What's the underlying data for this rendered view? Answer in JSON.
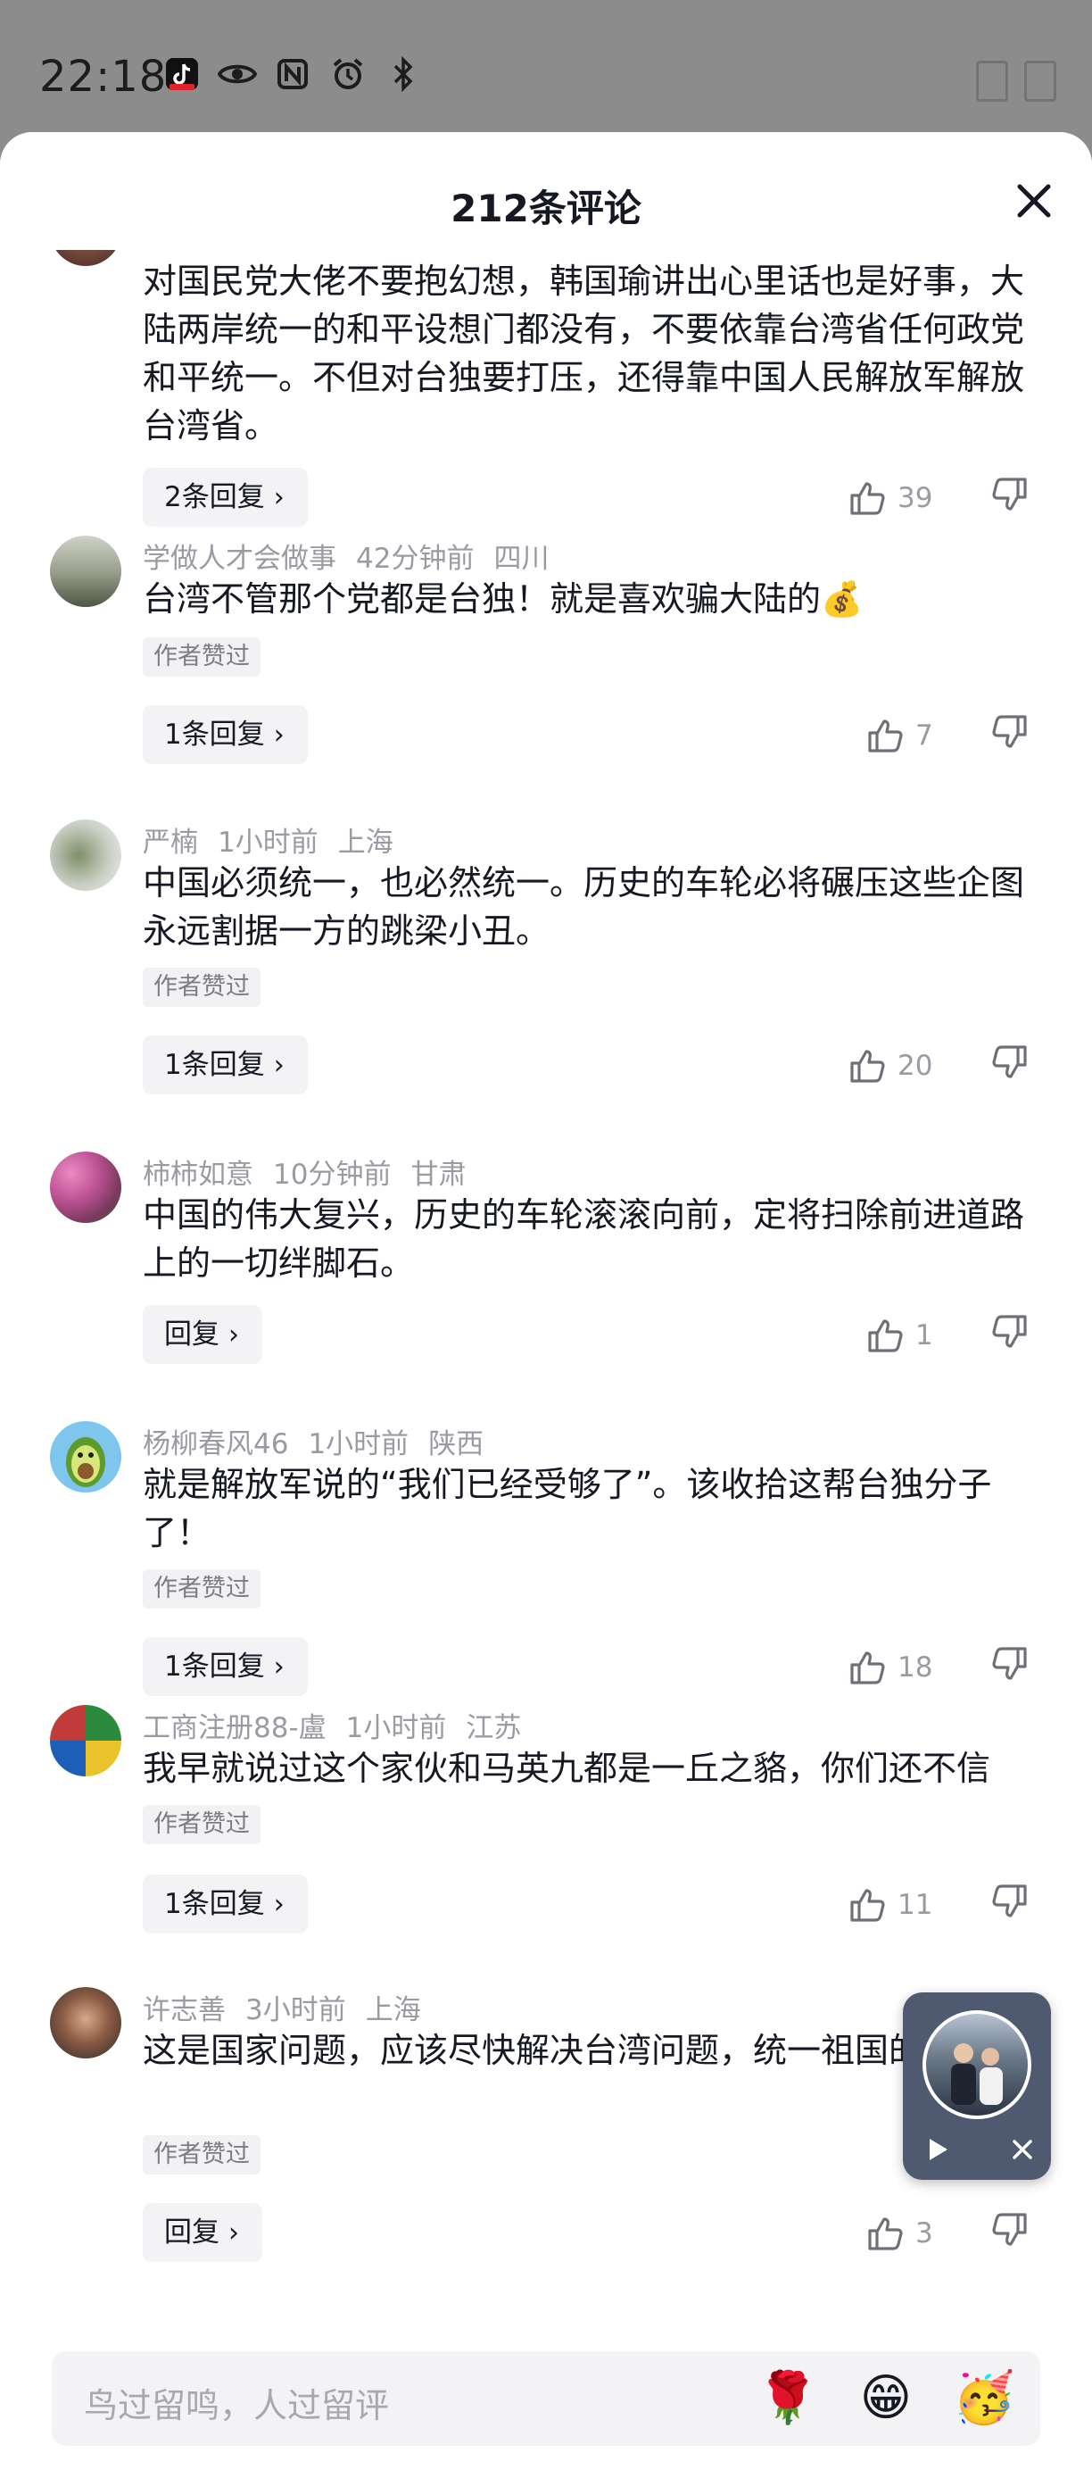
{
  "status_bar": {
    "time": "22:18"
  },
  "header": {
    "title": "212条评论"
  },
  "comments": [
    {
      "text": "对国民党大佬不要抱幻想，韩国瑜讲出心里话也是好事，大陆两岸统一的和平设想门都没有，不要依靠台湾省任何政党和平统一。不但对台独要打压，还得靠中国人民解放军解放台湾省。",
      "reply_label": "2条回复",
      "likes": "39"
    },
    {
      "username": "学做人才会做事",
      "time": "42分钟前",
      "location": "四川",
      "text": "台湾不管那个党都是台独！就是喜欢骗大陆的💰",
      "badge": "作者赞过",
      "reply_label": "1条回复",
      "likes": "7"
    },
    {
      "username": "严楠",
      "time": "1小时前",
      "location": "上海",
      "text": "中国必须统一，也必然统一。历史的车轮必将碾压这些企图永远割据一方的跳梁小丑。",
      "badge": "作者赞过",
      "reply_label": "1条回复",
      "likes": "20"
    },
    {
      "username": "柿柿如意",
      "time": "10分钟前",
      "location": "甘肃",
      "text": "中国的伟大复兴，历史的车轮滚滚向前，定将扫除前进道路上的一切绊脚石。",
      "reply_label": "回复",
      "likes": "1"
    },
    {
      "username": "杨柳春风46",
      "time": "1小时前",
      "location": "陕西",
      "text": "就是解放军说的“我们已经受够了”。该收拾这帮台独分子了！",
      "badge": "作者赞过",
      "reply_label": "1条回复",
      "likes": "18"
    },
    {
      "username": "工商注册88-盧",
      "time": "1小时前",
      "location": "江苏",
      "text": "我早就说过这个家伙和马英九都是一丘之貉，你们还不信",
      "badge": "作者赞过",
      "reply_label": "1条回复",
      "likes": "11"
    },
    {
      "username": "许志善",
      "time": "3小时前",
      "location": "上海",
      "text": "这是国家问题，应该尽快解决台湾问题，统一祖国的。",
      "badge": "作者赞过",
      "reply_label": "回复",
      "likes": "3"
    }
  ],
  "input": {
    "placeholder": "鸟过留鸣，人过留评"
  },
  "emojis": [
    "🌹",
    "😁",
    "🥳"
  ],
  "icons": {
    "status": [
      "douyin-icon",
      "eye-icon",
      "nfc-icon",
      "alarm-icon",
      "bluetooth-icon"
    ],
    "close": "close-icon",
    "like": "thumbs-up-icon",
    "dislike": "thumbs-down-icon",
    "chevron": "chevron-right-icon",
    "play": "play-icon"
  },
  "colors": {
    "sheet": "#ffffff",
    "overlay": "#8c8c8c",
    "muted": "#9a9ba2",
    "mini_player": "#4f5a70"
  }
}
